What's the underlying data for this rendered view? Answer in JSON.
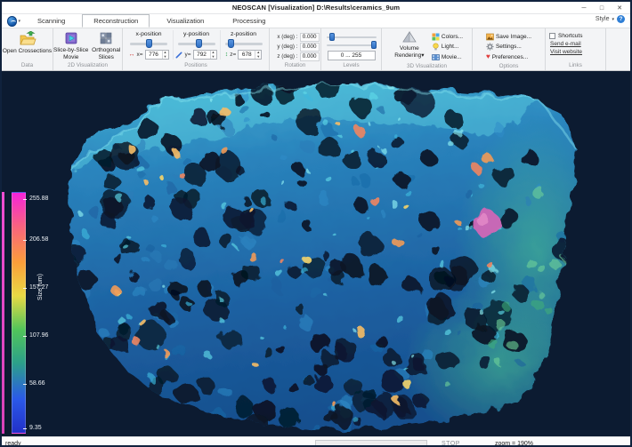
{
  "window": {
    "title": "NEOSCAN [Visualization] D:\\Results\\ceramics_9um",
    "minimize": "─",
    "maximize": "□",
    "close": "✕",
    "style_label": "Style",
    "help_glyph": "?"
  },
  "tabs": [
    {
      "label": "Scanning",
      "selected": false
    },
    {
      "label": "Reconstruction",
      "selected": true
    },
    {
      "label": "Visualization",
      "selected": false
    },
    {
      "label": "Processing",
      "selected": false
    }
  ],
  "ribbon": {
    "data": {
      "group_label": "Data",
      "open_crossections": "Open Crossections"
    },
    "viz2d": {
      "group_label": "2D Visualization",
      "slice_movie": "Slice-by-Slice Movie",
      "orthogonal": "Orthogonal Slices"
    },
    "positions": {
      "group_label": "Positions",
      "x_label": "x-position",
      "x_prefix": "x=",
      "x_value": "776",
      "y_label": "y-position",
      "y_prefix": "y=",
      "y_value": "792",
      "z_label": "z-position",
      "z_prefix": "z=",
      "z_value": "678",
      "x_icon": "↔",
      "z_icon": "↕"
    },
    "rotation": {
      "group_label": "Rotation",
      "x_label": "x (deg) :",
      "x_value": "0.000",
      "y_label": "y (deg) :",
      "y_value": "0.000",
      "z_label": "z (deg) :",
      "z_value": "0.000"
    },
    "levels": {
      "group_label": "Levels",
      "range_value": "0 ... 255"
    },
    "viz3d": {
      "group_label": "3D Visualization",
      "volume_rendering": "Volume Rendering",
      "caret": "▾",
      "colors": "Colors...",
      "light": "Light...",
      "movie": "Movie..."
    },
    "options": {
      "group_label": "Options",
      "save_image": "Save Image...",
      "settings": "Settings...",
      "preferences": "Preferences...",
      "heart_glyph": "♥"
    },
    "links": {
      "group_label": "Links",
      "shortcuts": "Shortcuts",
      "send_email": "Send e-mail",
      "visit_website": "Visit website"
    }
  },
  "colorbar": {
    "label": "Size (um)",
    "ticks": [
      "255.88",
      "206.58",
      "157.27",
      "107.96",
      "58.66",
      "9.35"
    ],
    "gradient_top_to_bottom": [
      "#f524da",
      "#f9637f",
      "#fb9e3a",
      "#e8d945",
      "#52c55a",
      "#2ca08a",
      "#2b59e8",
      "#2230c8"
    ],
    "edge_strip_colors": [
      "#ef4ed2",
      "#d843b8"
    ]
  },
  "statusbar": {
    "status": "ready",
    "stop": "STOP",
    "zoom": "zoom = 190%"
  },
  "viewport": {
    "background": "#0c1b31",
    "palette": {
      "base_top": "#46b9d8",
      "base_bottom": "#164f8e",
      "strut_blue": [
        "#1c5e9e",
        "#2f8cc9",
        "#2b7bb8",
        "#1a6aa8"
      ],
      "highlight_cyan": [
        "#5fd8e8",
        "#8ff0f2",
        "#3fb9dd"
      ],
      "pore_dark": [
        "#06101f",
        "#0a1830",
        "#041e2e",
        "#081426"
      ],
      "hot_spots": [
        "#f09a58",
        "#f6bd66",
        "#ee8560",
        "#f4d46a"
      ],
      "green_patch": [
        "#3fae7a",
        "#6fd29a"
      ],
      "pink_blob": "#d066b6"
    }
  }
}
